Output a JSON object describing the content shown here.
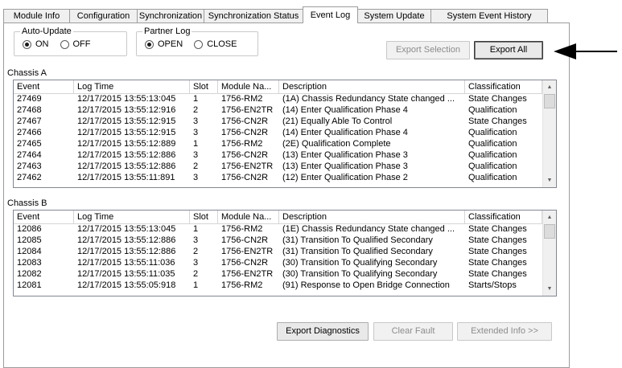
{
  "tabs": [
    {
      "label": "Module Info",
      "active": false
    },
    {
      "label": "Configuration",
      "active": false
    },
    {
      "label": "Synchronization",
      "active": false
    },
    {
      "label": "Synchronization Status",
      "active": false
    },
    {
      "label": "Event Log",
      "active": true
    },
    {
      "label": "System Update",
      "active": false
    },
    {
      "label": "System Event History",
      "active": false
    }
  ],
  "auto_update": {
    "title": "Auto-Update",
    "options": [
      {
        "label": "ON",
        "selected": true
      },
      {
        "label": "OFF",
        "selected": false
      }
    ]
  },
  "partner_log": {
    "title": "Partner Log",
    "options": [
      {
        "label": "OPEN",
        "selected": true
      },
      {
        "label": "CLOSE",
        "selected": false
      }
    ]
  },
  "buttons": {
    "export_selection": "Export Selection",
    "export_all": "Export All",
    "export_diagnostics": "Export Diagnostics",
    "clear_fault": "Clear Fault",
    "extended_info": "Extended Info >>"
  },
  "columns": [
    "Event",
    "Log Time",
    "Slot",
    "Module Na...",
    "Description",
    "Classification"
  ],
  "chassis_a": {
    "title": "Chassis A",
    "rows": [
      [
        "27469",
        "12/17/2015 13:55:13:045",
        "1",
        "1756-RM2",
        "(1A) Chassis Redundancy State changed ...",
        "State Changes"
      ],
      [
        "27468",
        "12/17/2015 13:55:12:916",
        "2",
        "1756-EN2TR",
        "(14) Enter Qualification Phase 4",
        "Qualification"
      ],
      [
        "27467",
        "12/17/2015 13:55:12:915",
        "3",
        "1756-CN2R",
        "(21) Equally Able To Control",
        "State Changes"
      ],
      [
        "27466",
        "12/17/2015 13:55:12:915",
        "3",
        "1756-CN2R",
        "(14) Enter Qualification Phase 4",
        "Qualification"
      ],
      [
        "27465",
        "12/17/2015 13:55:12:889",
        "1",
        "1756-RM2",
        "(2E) Qualification Complete",
        "Qualification"
      ],
      [
        "27464",
        "12/17/2015 13:55:12:886",
        "3",
        "1756-CN2R",
        "(13) Enter Qualification Phase 3",
        "Qualification"
      ],
      [
        "27463",
        "12/17/2015 13:55:12:886",
        "2",
        "1756-EN2TR",
        "(13) Enter Qualification Phase 3",
        "Qualification"
      ],
      [
        "27462",
        "12/17/2015 13:55:11:891",
        "3",
        "1756-CN2R",
        "(12) Enter Qualification Phase 2",
        "Qualification"
      ]
    ]
  },
  "chassis_b": {
    "title": "Chassis B",
    "rows": [
      [
        "12086",
        "12/17/2015 13:55:13:045",
        "1",
        "1756-RM2",
        "(1E) Chassis Redundancy State changed ...",
        "State Changes"
      ],
      [
        "12085",
        "12/17/2015 13:55:12:886",
        "3",
        "1756-CN2R",
        "(31) Transition To Qualified Secondary",
        "State Changes"
      ],
      [
        "12084",
        "12/17/2015 13:55:12:886",
        "2",
        "1756-EN2TR",
        "(31) Transition To Qualified Secondary",
        "State Changes"
      ],
      [
        "12083",
        "12/17/2015 13:55:11:036",
        "3",
        "1756-CN2R",
        "(30) Transition To Qualifying Secondary",
        "State Changes"
      ],
      [
        "12082",
        "12/17/2015 13:55:11:035",
        "2",
        "1756-EN2TR",
        "(30) Transition To Qualifying Secondary",
        "State Changes"
      ],
      [
        "12081",
        "12/17/2015 13:55:05:918",
        "1",
        "1756-RM2",
        "(91) Response to Open Bridge Connection",
        "Starts/Stops"
      ]
    ]
  },
  "icons": {
    "scroll_up": "scroll-up-arrow-icon",
    "scroll_down": "scroll-down-arrow-icon",
    "pointer": "left-pointing-arrow-icon"
  }
}
